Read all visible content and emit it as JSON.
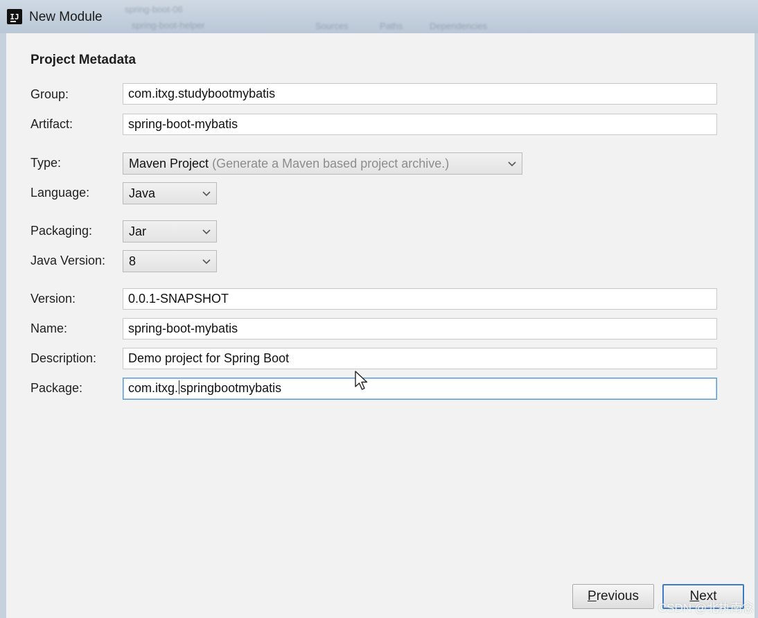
{
  "window": {
    "title": "New Module",
    "icon": "intellij-idea-icon",
    "background_hints": [
      "spring-boot-06",
      "spring-boot-helper",
      "Sources",
      "Paths",
      "Dependencies"
    ]
  },
  "form": {
    "section_title": "Project Metadata",
    "group": {
      "label": "Group:",
      "value": "com.itxg.studybootmybatis"
    },
    "artifact": {
      "label": "Artifact:",
      "value": "spring-boot-mybatis"
    },
    "type": {
      "label": "Type:",
      "value": "Maven Project",
      "hint": "(Generate a Maven based project archive.)"
    },
    "language": {
      "label": "Language:",
      "value": "Java"
    },
    "packaging": {
      "label": "Packaging:",
      "value": "Jar"
    },
    "java_version": {
      "label": "Java Version:",
      "value": "8"
    },
    "version": {
      "label": "Version:",
      "value": "0.0.1-SNAPSHOT"
    },
    "name": {
      "label": "Name:",
      "value": "spring-boot-mybatis"
    },
    "description": {
      "label": "Description:",
      "value": "Demo project for Spring Boot"
    },
    "package": {
      "label": "Package:",
      "value_before_caret": "com.itxg.",
      "value_after_caret": "springbootmybatis"
    }
  },
  "buttons": {
    "previous": {
      "mnemonic": "P",
      "rest": "revious"
    },
    "next": {
      "mnemonic": "N",
      "rest": "ext"
    }
  },
  "watermark": "CSDN @北执南念",
  "colors": {
    "focus_border": "#5a9bd6",
    "default_button_border": "#3b7ac6",
    "dialog_background": "#f2f2f2"
  }
}
